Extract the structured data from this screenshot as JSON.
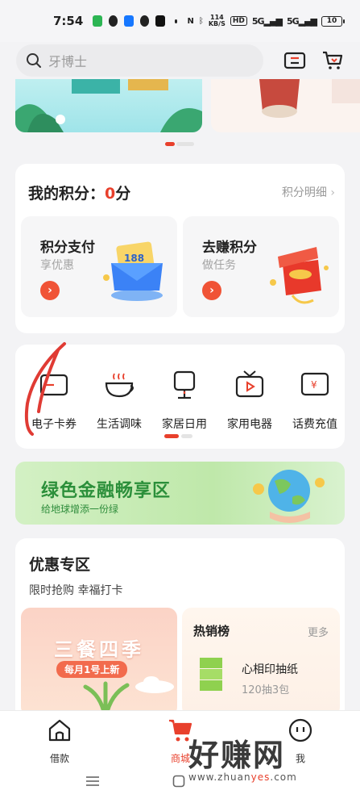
{
  "status_bar": {
    "time": "7:54",
    "net_speed": "114",
    "net_unit": "KB/S",
    "hd": "HD",
    "signal": "5G",
    "battery": "10"
  },
  "search": {
    "placeholder": "牙博士"
  },
  "points": {
    "title": "我的积分：",
    "value": "0",
    "unit": "分",
    "detail_link": "积分明细"
  },
  "points_cards": [
    {
      "title": "积分支付",
      "subtitle": "享优惠",
      "badge": "188"
    },
    {
      "title": "去赚积分",
      "subtitle": "做任务"
    }
  ],
  "categories": [
    {
      "label": "电子卡券",
      "icon": "card-icon"
    },
    {
      "label": "生活调味",
      "icon": "bowl-icon"
    },
    {
      "label": "家居日用",
      "icon": "lamp-icon"
    },
    {
      "label": "家用电器",
      "icon": "tv-icon"
    },
    {
      "label": "话费充值",
      "icon": "phone-bill-icon",
      "glyph": "¥"
    }
  ],
  "green_banner": {
    "title": "绿色金融畅享区",
    "subtitle": "给地球增添一份绿"
  },
  "deals": {
    "title": "优惠专区",
    "subtitle": "限时抢购 幸福打卡",
    "left": {
      "headline": "三餐四季",
      "pill": "每月1号上新"
    },
    "right": {
      "title": "热销榜",
      "more": "更多",
      "product": "心相印抽纸",
      "spec": "120抽3包"
    }
  },
  "bottom_nav": [
    {
      "label": "借款",
      "icon": "home-icon",
      "active": false
    },
    {
      "label": "商城",
      "icon": "cart-icon",
      "active": true
    },
    {
      "label": "我",
      "icon": "profile-icon",
      "active": false
    }
  ],
  "watermark": {
    "text": "好赚网",
    "url_pre": "www.zhuan",
    "url_y": "yes",
    "url_post": ".com"
  },
  "colors": {
    "accent": "#e8402c",
    "green": "#2b8f3a",
    "bg": "#f3f3f5"
  }
}
